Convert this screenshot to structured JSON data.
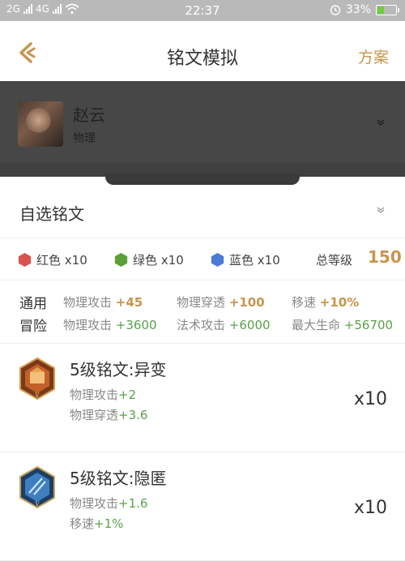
{
  "status_bar": {
    "signal_left": "2G",
    "signal_mid": "4G",
    "time": "22:37",
    "battery": "33%",
    "battery_level": 0.33
  },
  "nav": {
    "title": "铭文模拟",
    "right_action": "方案",
    "back_icon": "back-chevron-icon"
  },
  "hero": {
    "name": "赵云",
    "type": "物理"
  },
  "custom": {
    "title": "自选铭文"
  },
  "colors": {
    "red": {
      "label": "红色 x10",
      "color": "#d9534f"
    },
    "green": {
      "label": "绿色 x10",
      "color": "#5aa037"
    },
    "blue": {
      "label": "蓝色 x10",
      "color": "#4a7bd6"
    },
    "total_label": "总等级",
    "total_value": "150"
  },
  "stats": {
    "general": {
      "label": "通用",
      "cells": [
        {
          "name": "物理攻击",
          "value": "+45"
        },
        {
          "name": "物理穿透",
          "value": "+100"
        },
        {
          "name": "移速",
          "value": "+10%"
        }
      ]
    },
    "adventure": {
      "label": "冒险",
      "cells": [
        {
          "name": "物理攻击",
          "value": "+3600"
        },
        {
          "name": "法术攻击",
          "value": "+6000"
        },
        {
          "name": "最大生命",
          "value": "+56700"
        }
      ]
    }
  },
  "inscriptions": [
    {
      "name": "5级铭文:异变",
      "attrs": [
        {
          "name": "物理攻击",
          "value": "+2"
        },
        {
          "name": "物理穿透",
          "value": "+3.6"
        }
      ],
      "count": "x10",
      "color": "#b5532a"
    },
    {
      "name": "5级铭文:隐匿",
      "attrs": [
        {
          "name": "物理攻击",
          "value": "+1.6"
        },
        {
          "name": "移速",
          "value": "+1%"
        }
      ],
      "count": "x10",
      "color": "#3f7fbf"
    }
  ]
}
